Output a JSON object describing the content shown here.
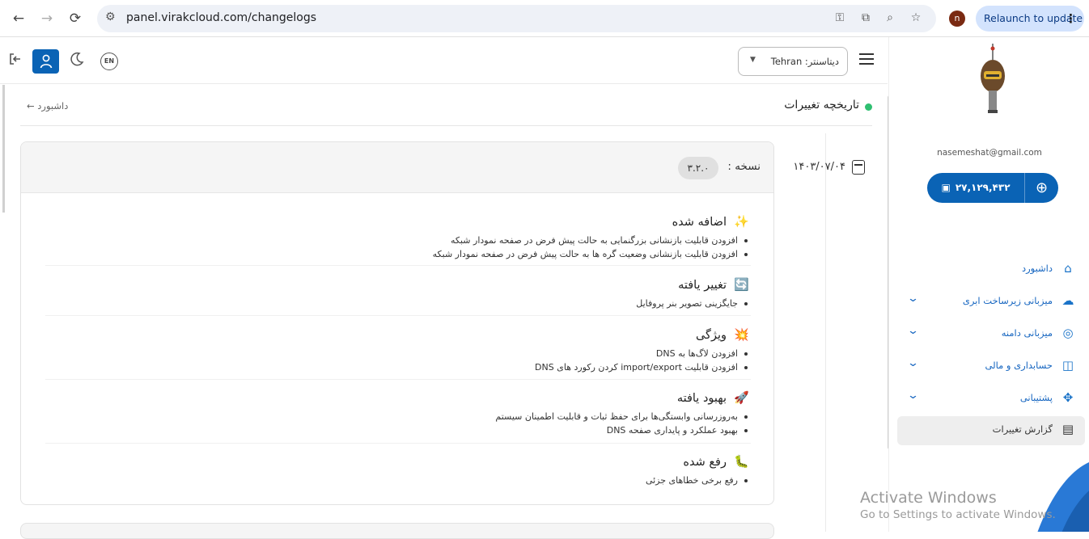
{
  "browser": {
    "url": "panel.virakcloud.com/changelogs",
    "profile_initial": "n",
    "relaunch_label": "Relaunch to update"
  },
  "topbar": {
    "datacenter_label": "دیتاسنتر: Tehran",
    "language_label": "EN"
  },
  "sidebar": {
    "email": "nasemeshat@gmail.com",
    "balance": "۲۷,۱۲۹,۴۳۲",
    "items": [
      {
        "label": "داشبورد",
        "icon": "home-icon",
        "has_submenu": false
      },
      {
        "label": "میزبانی زیرساخت ابری",
        "icon": "cloud-icon",
        "has_submenu": true
      },
      {
        "label": "میزبانی دامنه",
        "icon": "dns-icon",
        "has_submenu": true
      },
      {
        "label": "حسابداری و مالی",
        "icon": "bag-icon",
        "has_submenu": true
      },
      {
        "label": "پشتیبانی",
        "icon": "puzzle-icon",
        "has_submenu": true
      },
      {
        "label": "گزارش تغییرات",
        "icon": "report-icon",
        "has_submenu": false,
        "active": true
      }
    ]
  },
  "page": {
    "title": "تاریخچه تغییرات",
    "back_label": "داشبورد ←"
  },
  "changelog": {
    "date": "۱۴۰۳/۰۷/۰۴",
    "version_label": "نسخه :",
    "version": "۳.۲.۰",
    "sections": [
      {
        "title": "اضافه شده",
        "emoji": "✨",
        "items": [
          "افزودن قابلیت بازنشانی بزرگنمایی به حالت پیش فرض در صفحه نمودار شبکه",
          "افزودن قابلیت بازنشانی وضعیت گره ها به حالت پیش فرض در صفحه نمودار شبکه"
        ]
      },
      {
        "title": "تغییر یافته",
        "emoji": "🔄",
        "items": [
          "جایگزینی تصویر بنر پروفایل"
        ]
      },
      {
        "title": "ویژگی",
        "emoji": "💥",
        "items": [
          "افزودن لاگ‌ها به DNS",
          "افزودن قابلیت import/export کردن رکورد های DNS"
        ]
      },
      {
        "title": "بهبود یافته",
        "emoji": "🚀",
        "items": [
          "به‌روزرسانی وابستگی‌ها برای حفظ ثبات و قابلیت اطمینان سیستم",
          "بهبود عملکرد و پایداری صفحه DNS"
        ]
      },
      {
        "title": "رفع شده",
        "emoji": "🐛",
        "items": [
          "رفع برخی خطاهای جزئی"
        ]
      }
    ]
  },
  "watermark": {
    "line1": "Activate Windows",
    "line2": "Go to Settings to activate Windows."
  },
  "colors": {
    "primary": "#0a63b5",
    "status_dot": "#2fbf71",
    "menu_text": "#1565c0"
  }
}
